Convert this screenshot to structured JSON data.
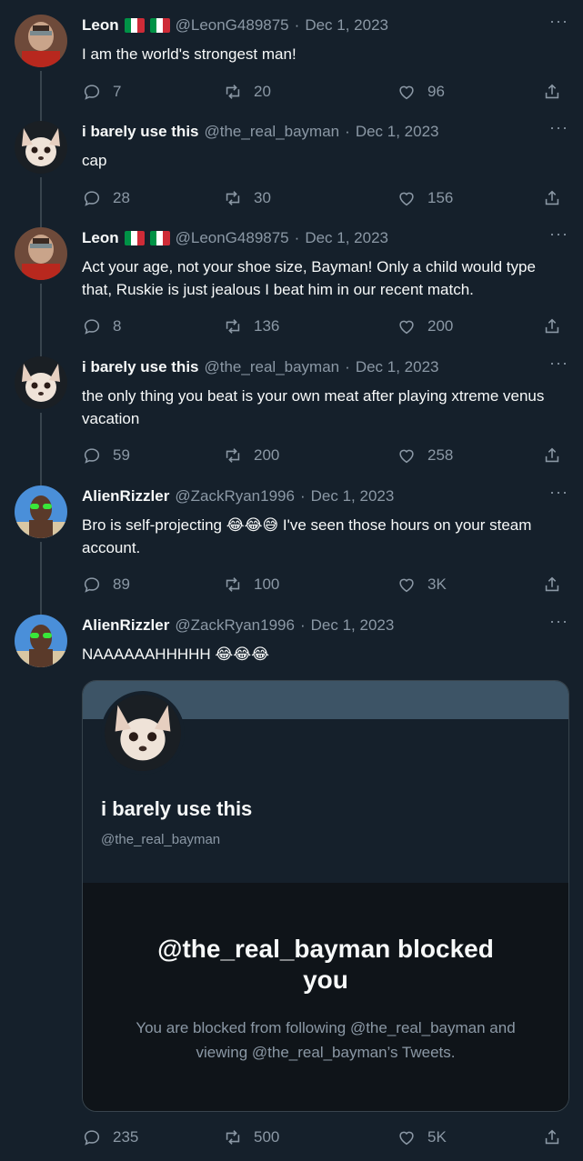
{
  "tweets": [
    {
      "name": "Leon",
      "flags": true,
      "handle": "@LeonG489875",
      "sep": "·",
      "date": "Dec 1, 2023",
      "text": "I am the world's strongest man!",
      "replies": "7",
      "retweets": "20",
      "likes": "96",
      "avatar": "leon"
    },
    {
      "name": "i barely use this",
      "flags": false,
      "handle": "@the_real_bayman",
      "sep": "·",
      "date": "Dec 1, 2023",
      "text": "cap",
      "replies": "28",
      "retweets": "30",
      "likes": "156",
      "avatar": "dog"
    },
    {
      "name": "Leon",
      "flags": true,
      "handle": "@LeonG489875",
      "sep": "·",
      "date": "Dec 1, 2023",
      "text": "Act your age, not your shoe size, Bayman! Only a child would type that, Ruskie is just jealous I beat him in our recent match.",
      "replies": "8",
      "retweets": "136",
      "likes": "200",
      "avatar": "leon"
    },
    {
      "name": "i barely use this",
      "flags": false,
      "handle": "@the_real_bayman",
      "sep": "·",
      "date": "Dec 1, 2023",
      "text": "the only thing you beat is your own meat after playing xtreme venus vacation",
      "replies": "59",
      "retweets": "200",
      "likes": "258",
      "avatar": "dog"
    },
    {
      "name": "AlienRizzler",
      "flags": false,
      "handle": "@ZackRyan1996",
      "sep": "·",
      "date": "Dec 1, 2023",
      "text": "Bro is self-projecting 😂😂😅 I've seen those hours on your steam account.",
      "replies": "89",
      "retweets": "100",
      "likes": "3K",
      "avatar": "alien"
    },
    {
      "name": "AlienRizzler",
      "flags": false,
      "handle": "@ZackRyan1996",
      "sep": "·",
      "date": "Dec 1, 2023",
      "text": "NAAAAAAHHHHH 😂😂😂",
      "replies": "235",
      "retweets": "500",
      "likes": "5K",
      "avatar": "alien"
    }
  ],
  "card": {
    "name": "i barely use this",
    "handle": "@the_real_bayman",
    "blocked_title": "@the_real_bayman blocked you",
    "blocked_sub": "You are blocked from following @the_real_bayman and viewing @the_real_bayman’s Tweets."
  },
  "more_label": "···",
  "colors": {
    "background": "#15202b",
    "muted": "#8b98a5",
    "line": "#38444d",
    "banner": "#3d5466"
  }
}
